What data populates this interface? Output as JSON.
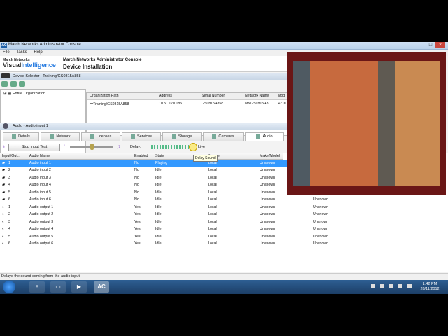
{
  "window": {
    "title": "March Networks Administrator Console",
    "app_icon": "AC"
  },
  "menu": [
    "File",
    "Tasks",
    "Help"
  ],
  "brand": {
    "top": "March Networks",
    "main_a": "Visual",
    "main_b": "Intelligence"
  },
  "header": {
    "title": "March Networks Administrator Console",
    "subtitle": "Device Installation"
  },
  "device_selector": {
    "label": "Device Selector - Training/GS0815A858"
  },
  "tree": {
    "root": "Entire Organization"
  },
  "org_table": {
    "columns": [
      "Organization Path",
      "Address",
      "Serial Number",
      "Network Name",
      "Mod"
    ],
    "row": [
      "Training\\GS0815A858",
      "10.51.170.185",
      "GS0815A858",
      "MNGS0815A8...",
      "4216"
    ]
  },
  "section": {
    "label": "Audio - Audio input 1"
  },
  "tabs": [
    "Details",
    "Network",
    "Licenses",
    "Services",
    "Storage",
    "Cameras",
    "Audio"
  ],
  "controls": {
    "stop_button": "Stop Input Test",
    "delay_label": "Delay:",
    "live_label": "Live",
    "tooltip": "Delay Sound"
  },
  "grid": {
    "columns": [
      "Input/Out...",
      "Audio Name",
      "Enabled",
      "State",
      "Source",
      "Make/Model"
    ],
    "rows": [
      [
        "1",
        "Audio input 1",
        "No",
        "Playing",
        "Local",
        "Unknown",
        ""
      ],
      [
        "2",
        "Audio input 2",
        "No",
        "Idle",
        "Local",
        "Unknown",
        ""
      ],
      [
        "3",
        "Audio input 3",
        "No",
        "Idle",
        "Local",
        "Unknown",
        ""
      ],
      [
        "4",
        "Audio input 4",
        "No",
        "Idle",
        "Local",
        "Unknown",
        ""
      ],
      [
        "5",
        "Audio input 5",
        "No",
        "Idle",
        "Local",
        "Unknown",
        ""
      ],
      [
        "6",
        "Audio input 6",
        "No",
        "Idle",
        "Local",
        "Unknown",
        "Unknown"
      ],
      [
        "1",
        "Audio output 1",
        "Yes",
        "Idle",
        "Local",
        "Unknown",
        "Unknown"
      ],
      [
        "2",
        "Audio output 2",
        "Yes",
        "Idle",
        "Local",
        "Unknown",
        "Unknown"
      ],
      [
        "3",
        "Audio output 3",
        "Yes",
        "Idle",
        "Local",
        "Unknown",
        "Unknown"
      ],
      [
        "4",
        "Audio output 4",
        "Yes",
        "Idle",
        "Local",
        "Unknown",
        "Unknown"
      ],
      [
        "5",
        "Audio output 5",
        "Yes",
        "Idle",
        "Local",
        "Unknown",
        "Unknown"
      ],
      [
        "6",
        "Audio output 6",
        "Yes",
        "Idle",
        "Local",
        "Unknown",
        "Unknown"
      ]
    ]
  },
  "status": "Delays the sound coming from the audio input",
  "taskbar": {
    "time": "1:42 PM",
    "date": "28/11/2012",
    "active_app": "AC"
  },
  "colors": {
    "selection": "#3399ff",
    "video_bg": "#6a1616",
    "taskbar": "#1c3e66"
  }
}
